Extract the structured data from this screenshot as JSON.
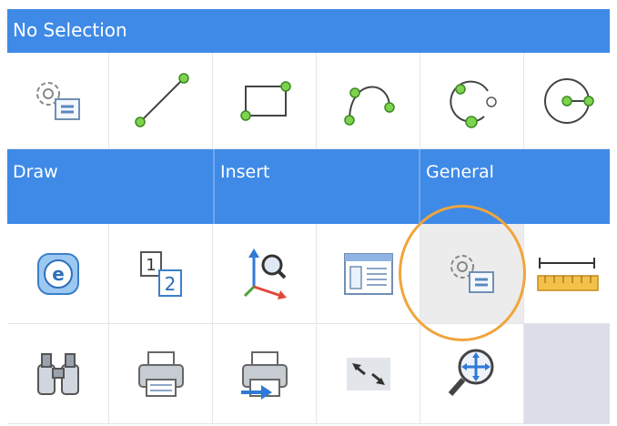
{
  "panel": {
    "title": "No Selection",
    "accent_color": "#3f8ae6",
    "highlight_ring_color": "#f0a53c"
  },
  "sections": {
    "draw": "Draw",
    "insert": "Insert",
    "general": "General"
  },
  "tools_row1": [
    "settings-icon",
    "line-icon",
    "rectangle-icon",
    "arc-icon",
    "circle-3pt-icon",
    "circle-center-icon"
  ],
  "tools_row3": [
    "explorer-e-icon",
    "numbered-views-icon",
    "ucs-zoom-icon",
    "layout-panel-icon",
    "settings-icon",
    "measure-ruler-icon"
  ],
  "tools_row4": [
    "binoculars-icon",
    "print-icon",
    "print-export-icon",
    "resize-arrows-icon",
    "zoom-pan-icon"
  ]
}
